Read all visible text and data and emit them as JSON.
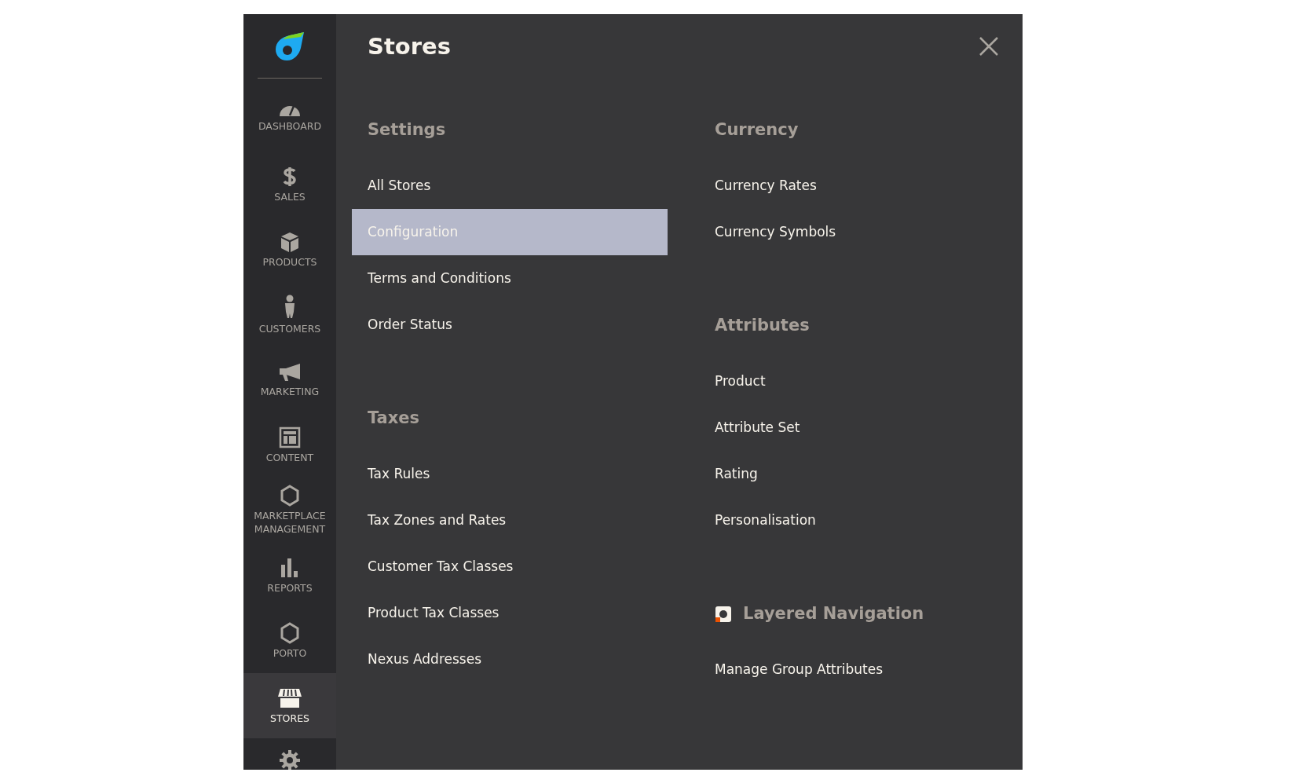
{
  "sidebar": {
    "items": [
      {
        "label": "DASHBOARD",
        "selected": false
      },
      {
        "label": "SALES",
        "selected": false
      },
      {
        "label": "PRODUCTS",
        "selected": false
      },
      {
        "label": "CUSTOMERS",
        "selected": false
      },
      {
        "label": "MARKETING",
        "selected": false
      },
      {
        "label": "CONTENT",
        "selected": false
      },
      {
        "label": "MARKETPLACE MANAGEMENT",
        "selected": false
      },
      {
        "label": "REPORTS",
        "selected": false
      },
      {
        "label": "PORTO",
        "selected": false
      },
      {
        "label": "STORES",
        "selected": true
      }
    ]
  },
  "panel": {
    "title": "Stores",
    "columns": [
      [
        {
          "heading": "Settings",
          "items": [
            {
              "label": "All Stores",
              "selected": false
            },
            {
              "label": "Configuration",
              "selected": true
            },
            {
              "label": "Terms and Conditions",
              "selected": false
            },
            {
              "label": "Order Status",
              "selected": false
            }
          ]
        },
        {
          "heading": "Taxes",
          "items": [
            {
              "label": "Tax Rules",
              "selected": false
            },
            {
              "label": "Tax Zones and Rates",
              "selected": false
            },
            {
              "label": "Customer Tax Classes",
              "selected": false
            },
            {
              "label": "Product Tax Classes",
              "selected": false
            },
            {
              "label": "Nexus Addresses",
              "selected": false
            }
          ]
        }
      ],
      [
        {
          "heading": "Currency",
          "items": [
            {
              "label": "Currency Rates",
              "selected": false
            },
            {
              "label": "Currency Symbols",
              "selected": false
            }
          ]
        },
        {
          "heading": "Attributes",
          "items": [
            {
              "label": "Product",
              "selected": false
            },
            {
              "label": "Attribute Set",
              "selected": false
            },
            {
              "label": "Rating",
              "selected": false
            },
            {
              "label": "Personalisation",
              "selected": false
            }
          ]
        },
        {
          "heading": "Layered Navigation",
          "kind": "extension",
          "items": [
            {
              "label": "Manage Group Attributes",
              "selected": false
            }
          ]
        }
      ]
    ]
  }
}
